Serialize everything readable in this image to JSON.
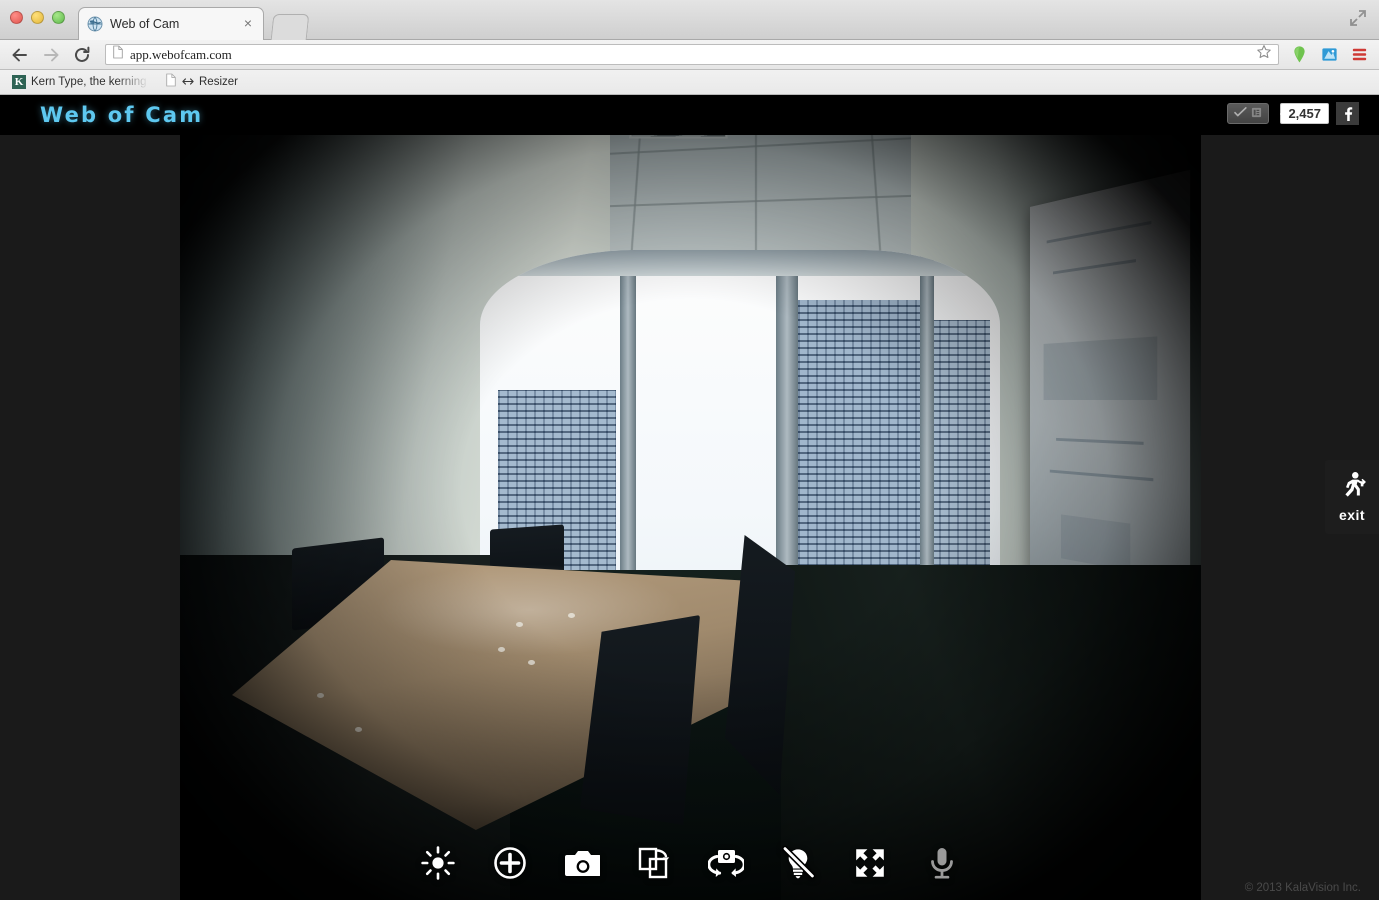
{
  "browser": {
    "window_controls": [
      "close",
      "minimize",
      "maximize"
    ],
    "tab": {
      "title": "Web of Cam",
      "favicon": "globe-icon",
      "close_label": "×"
    },
    "new_tab_label": "",
    "nav": {
      "back": "back-icon",
      "forward": "forward-icon",
      "reload": "reload-icon"
    },
    "omnibox": {
      "url": "app.webofcam.com",
      "page_icon": "page-icon",
      "star": "star-icon"
    },
    "toolbar_icons": [
      "location-pin-icon",
      "extension-icon",
      "chrome-menu-icon"
    ],
    "bookmarks": [
      {
        "label": "Kern Type, the kerning game",
        "icon": "kern-type-icon"
      },
      {
        "label": "Resizer",
        "icon": "resizer-icon"
      }
    ]
  },
  "app": {
    "logo": "Web of Cam",
    "logo_color": "#5ec8f0",
    "social": {
      "like_label": "",
      "like_icon": "facebook-like-icon",
      "count": "2,457",
      "facebook_glyph": "f"
    },
    "exit": {
      "label": "exit",
      "icon": "running-person-exit-icon"
    },
    "copyright": "© 2013 KalaVision Inc.",
    "controls": [
      {
        "name": "brightness",
        "icon": "sun-brightness-icon",
        "state": "active"
      },
      {
        "name": "zoom-in",
        "icon": "plus-circle-icon",
        "state": "active"
      },
      {
        "name": "snapshot",
        "icon": "camera-icon",
        "state": "active"
      },
      {
        "name": "flip-image",
        "icon": "flip-pages-icon",
        "state": "active"
      },
      {
        "name": "switch-camera",
        "icon": "camera-rotate-icon",
        "state": "active"
      },
      {
        "name": "night-mode",
        "icon": "lightbulb-off-icon",
        "state": "active"
      },
      {
        "name": "fullscreen",
        "icon": "fullscreen-arrows-icon",
        "state": "active"
      },
      {
        "name": "microphone",
        "icon": "microphone-icon",
        "state": "muted"
      }
    ],
    "video": {
      "alt": "Live fisheye webcam view of an empty conference room with a wooden table, dark chairs, and floor-to-ceiling windows overlooking city skyscrapers",
      "status": "live"
    }
  }
}
